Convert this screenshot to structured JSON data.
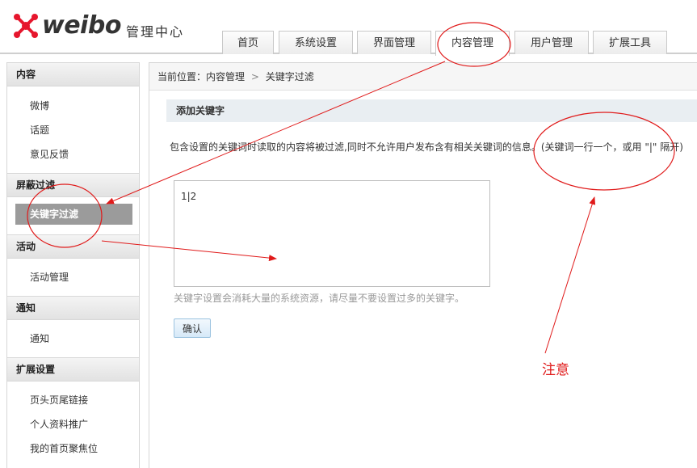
{
  "header": {
    "logo_text": "weibo",
    "logo_subtitle": "管理中心"
  },
  "nav": {
    "tabs": [
      {
        "label": "首页"
      },
      {
        "label": "系统设置"
      },
      {
        "label": "界面管理"
      },
      {
        "label": "内容管理",
        "active": true
      },
      {
        "label": "用户管理"
      },
      {
        "label": "扩展工具"
      }
    ]
  },
  "sidebar": {
    "sections": [
      {
        "title": "内容",
        "items": [
          "微博",
          "话题",
          "意见反馈"
        ]
      },
      {
        "title": "屏蔽过滤",
        "items": [
          "关键字过滤"
        ]
      },
      {
        "title": "活动",
        "items": [
          "活动管理"
        ]
      },
      {
        "title": "通知",
        "items": [
          "通知"
        ]
      },
      {
        "title": "扩展设置",
        "items": [
          "页头页尾链接",
          "个人资料推广",
          "我的首页聚焦位"
        ]
      }
    ]
  },
  "breadcrumb": {
    "prefix": "当前位置：",
    "level1": "内容管理",
    "separator": ">",
    "level2": "关键字过滤"
  },
  "form": {
    "section_title": "添加关键字",
    "description": "包含设置的关键词时读取的内容将被过滤,同时不允许用户发布含有相关关键词的信息。(关键词一行一个，或用 \"|\" 隔开)",
    "keywords_value": "1|2",
    "hint": "关键字设置会消耗大量的系统资源，请尽量不要设置过多的关键字。",
    "confirm_label": "确认"
  },
  "annotation": {
    "note": "注意",
    "color": "#e01a1a"
  }
}
